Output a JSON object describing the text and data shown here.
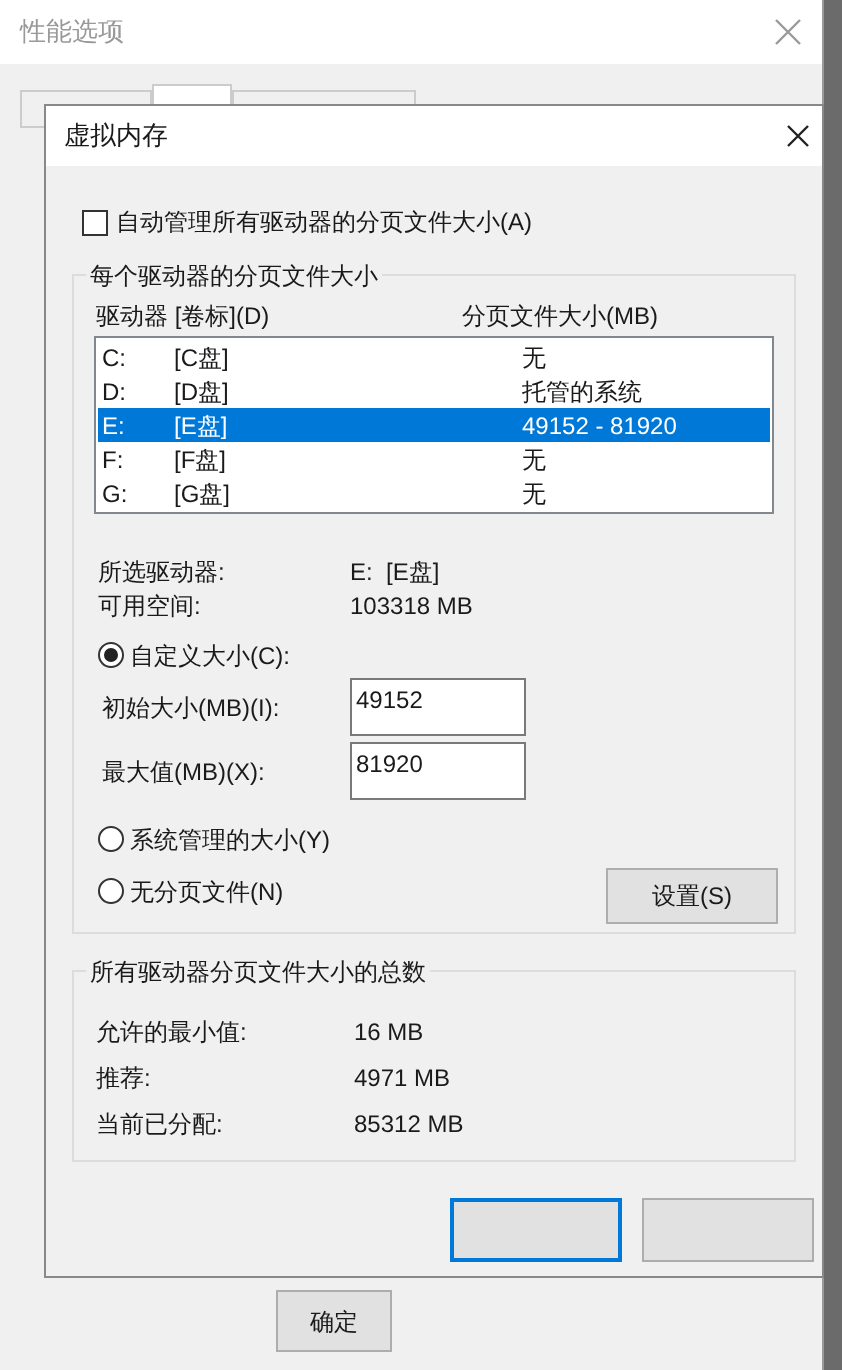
{
  "parent_window": {
    "title": "性能选项",
    "tabs": [
      {
        "selected": false
      },
      {
        "selected": true
      },
      {
        "selected": false
      }
    ],
    "buttons": [
      "确定"
    ]
  },
  "dialog": {
    "title": "虚拟内存",
    "auto_manage": {
      "label": "自动管理所有驱动器的分页文件大小(A)",
      "checked": false
    },
    "per_drive": {
      "title": "每个驱动器的分页文件大小",
      "columns": [
        "驱动器 [卷标](D)",
        "分页文件大小(MB)"
      ],
      "rows": [
        {
          "drive": "C:",
          "label": "[C盘]",
          "size": "无",
          "selected": false
        },
        {
          "drive": "D:",
          "label": "[D盘]",
          "size": "托管的系统",
          "selected": false
        },
        {
          "drive": "E:",
          "label": "[E盘]",
          "size": "49152 - 81920",
          "selected": true
        },
        {
          "drive": "F:",
          "label": "[F盘]",
          "size": "无",
          "selected": false
        },
        {
          "drive": "G:",
          "label": "[G盘]",
          "size": "无",
          "selected": false
        }
      ],
      "info": [
        {
          "label": "所选驱动器:",
          "value": "E:  [E盘]"
        },
        {
          "label": "可用空间:",
          "value": "103318 MB"
        }
      ],
      "options": [
        {
          "kind": "custom",
          "label": "自定义大小(C):",
          "selected": true,
          "fields": [
            {
              "label": "初始大小(MB)(I):",
              "value": "49152"
            },
            {
              "label": "最大值(MB)(X):",
              "value": "81920"
            }
          ]
        },
        {
          "kind": "plain",
          "label": "系统管理的大小(Y)",
          "selected": false
        },
        {
          "kind": "plain",
          "label": "无分页文件(N)",
          "selected": false
        }
      ],
      "set_button": "设置(S)"
    },
    "totals": {
      "title": "所有驱动器分页文件大小的总数",
      "rows": [
        {
          "label": "允许的最小值:",
          "value": "16 MB"
        },
        {
          "label": "推荐:",
          "value": "4971 MB"
        },
        {
          "label": "当前已分配:",
          "value": "85312 MB"
        }
      ]
    }
  }
}
